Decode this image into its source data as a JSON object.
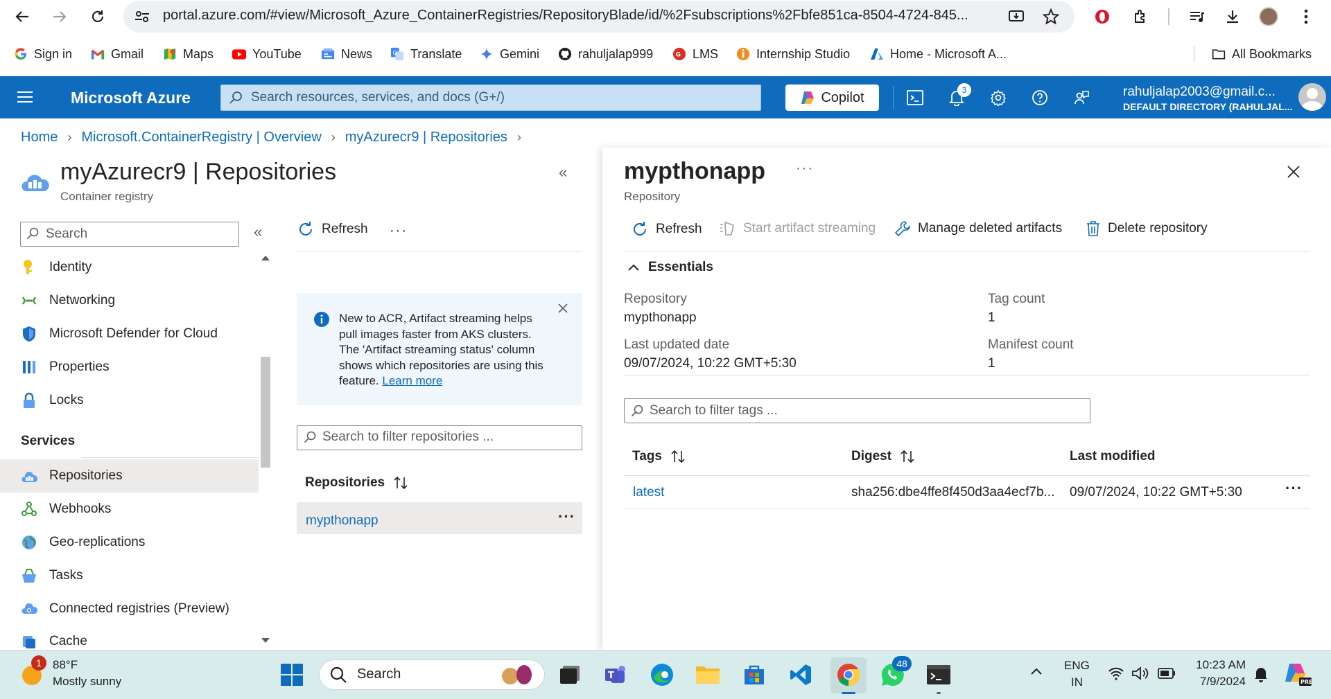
{
  "browser": {
    "url": "portal.azure.com/#view/Microsoft_Azure_ContainerRegistries/RepositoryBlade/id/%2Fsubscriptions%2Fbfe851ca-8504-4724-845...",
    "bookmarks": [
      {
        "label": "Sign in",
        "icon": "google-icon"
      },
      {
        "label": "Gmail",
        "icon": "gmail-icon"
      },
      {
        "label": "Maps",
        "icon": "maps-icon"
      },
      {
        "label": "YouTube",
        "icon": "youtube-icon"
      },
      {
        "label": "News",
        "icon": "news-icon"
      },
      {
        "label": "Translate",
        "icon": "translate-icon"
      },
      {
        "label": "Gemini",
        "icon": "gemini-icon"
      },
      {
        "label": "rahuljalap999",
        "icon": "github-icon"
      },
      {
        "label": "LMS",
        "icon": "lms-icon"
      },
      {
        "label": "Internship Studio",
        "icon": "internship-icon"
      },
      {
        "label": "Home - Microsoft A...",
        "icon": "azure-icon"
      }
    ],
    "all_bookmarks": "All Bookmarks"
  },
  "azure": {
    "brand": "Microsoft Azure",
    "search_placeholder": "Search resources, services, and docs (G+/)",
    "copilot": "Copilot",
    "notifications_count": "3",
    "account_name": "rahuljalap2003@gmail.c...",
    "account_directory": "DEFAULT DIRECTORY (RAHULJAL..."
  },
  "breadcrumb": [
    "Home",
    "Microsoft.ContainerRegistry | Overview",
    "myAzurecr9 | Repositories"
  ],
  "blade": {
    "title": "myAzurecr9 | Repositories",
    "subtitle": "Container registry",
    "search_placeholder": "Search",
    "menu_items": [
      "Identity",
      "Networking",
      "Microsoft Defender for Cloud",
      "Properties",
      "Locks"
    ],
    "services_heading": "Services",
    "service_items": [
      "Repositories",
      "Webhooks",
      "Geo-replications",
      "Tasks",
      "Connected registries (Preview)",
      "Cache"
    ]
  },
  "repos": {
    "refresh": "Refresh",
    "info_text": "New to ACR, Artifact streaming helps pull images faster from AKS clusters. The 'Artifact streaming status' column shows which repositories are using this feature.",
    "learn_more": "Learn more",
    "filter_placeholder": "Search to filter repositories ...",
    "column_header": "Repositories",
    "items": [
      "mypthonapp"
    ]
  },
  "detail": {
    "title": "mypthonapp",
    "subtitle": "Repository",
    "toolbar": {
      "refresh": "Refresh",
      "streaming": "Start artifact streaming",
      "manage_deleted": "Manage deleted artifacts",
      "delete": "Delete repository"
    },
    "essentials_label": "Essentials",
    "essentials": {
      "repository_label": "Repository",
      "repository_value": "mypthonapp",
      "tag_count_label": "Tag count",
      "tag_count_value": "1",
      "last_updated_label": "Last updated date",
      "last_updated_value": "09/07/2024, 10:22 GMT+5:30",
      "manifest_count_label": "Manifest count",
      "manifest_count_value": "1"
    },
    "tag_filter_placeholder": "Search to filter tags ...",
    "table": {
      "headers": [
        "Tags",
        "Digest",
        "Last modified"
      ],
      "rows": [
        {
          "tag": "latest",
          "digest": "sha256:dbe4ffe8f450d3aa4ecf7b...",
          "modified": "09/07/2024, 10:22 GMT+5:30"
        }
      ]
    }
  },
  "taskbar": {
    "weather_temp": "88°F",
    "weather_desc": "Mostly sunny",
    "weather_badge": "1",
    "search": "Search",
    "whatsapp_badge": "48",
    "lang": "ENG",
    "region": "IN",
    "time": "10:23 AM",
    "date": "7/9/2024"
  },
  "colors": {
    "azure_blue": "#0f6cbd",
    "link": "#0f6cbd",
    "info_bg": "#eff6fc",
    "taskbar": "#d9ecec"
  }
}
